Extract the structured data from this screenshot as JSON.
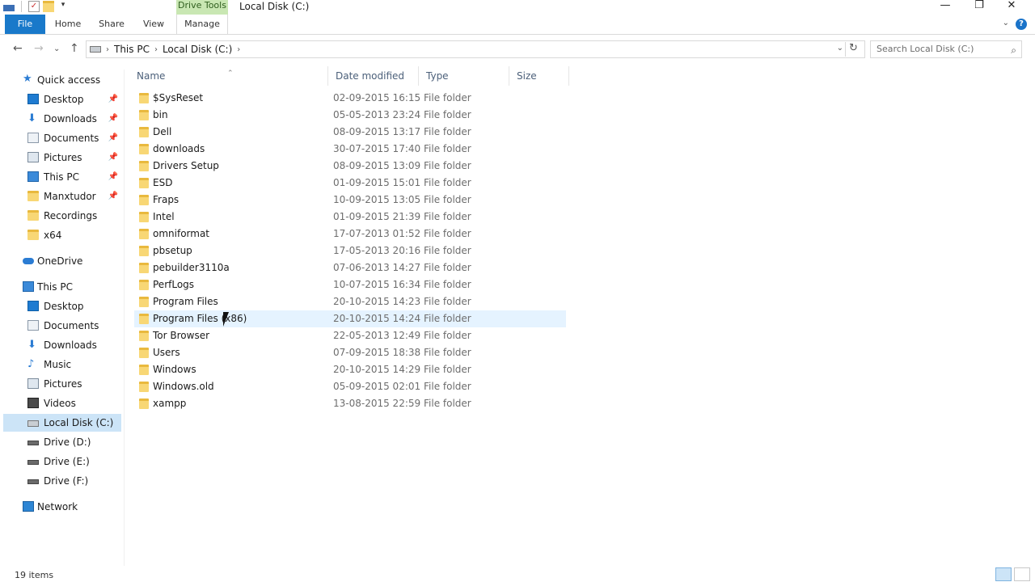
{
  "window": {
    "context_tab": "Drive Tools",
    "title": "Local Disk (C:)",
    "minimize_glyph": "—",
    "maximize_glyph": "❐",
    "close_glyph": "✕"
  },
  "ribbon": {
    "tabs": [
      {
        "label": "File"
      },
      {
        "label": "Home"
      },
      {
        "label": "Share"
      },
      {
        "label": "View"
      },
      {
        "label": "Manage"
      }
    ],
    "help_glyph": "?"
  },
  "address": {
    "crumbs": [
      "This PC",
      "Local Disk (C:)"
    ],
    "search_placeholder": "Search Local Disk (C:)"
  },
  "nav": {
    "quick_access": "Quick access",
    "quick_items": [
      {
        "label": "Desktop",
        "icon": "desktop-icon",
        "pinned": true
      },
      {
        "label": "Downloads",
        "icon": "downloads-icon",
        "pinned": true
      },
      {
        "label": "Documents",
        "icon": "documents-icon",
        "pinned": true
      },
      {
        "label": "Pictures",
        "icon": "pictures-icon",
        "pinned": true
      },
      {
        "label": "This PC",
        "icon": "this-pc-icon",
        "pinned": true
      },
      {
        "label": "Manxtudor",
        "icon": "folder-icon",
        "pinned": true
      },
      {
        "label": "Recordings",
        "icon": "folder-icon",
        "pinned": false
      },
      {
        "label": "x64",
        "icon": "folder-icon",
        "pinned": false
      }
    ],
    "onedrive": "OneDrive",
    "this_pc": "This PC",
    "pc_items": [
      {
        "label": "Desktop",
        "icon": "desktop-icon"
      },
      {
        "label": "Documents",
        "icon": "documents-icon"
      },
      {
        "label": "Downloads",
        "icon": "downloads-icon"
      },
      {
        "label": "Music",
        "icon": "music-icon"
      },
      {
        "label": "Pictures",
        "icon": "pictures-icon"
      },
      {
        "label": "Videos",
        "icon": "videos-icon"
      },
      {
        "label": "Local Disk (C:)",
        "icon": "local-disk-icon",
        "selected": true
      },
      {
        "label": "Drive (D:)",
        "icon": "drive-icon"
      },
      {
        "label": "Drive (E:)",
        "icon": "drive-icon"
      },
      {
        "label": "Drive (F:)",
        "icon": "drive-icon"
      }
    ],
    "network": "Network"
  },
  "columns": {
    "name": "Name",
    "date": "Date modified",
    "type": "Type",
    "size": "Size"
  },
  "files": [
    {
      "name": "$SysReset",
      "date": "02-09-2015 16:15",
      "type": "File folder"
    },
    {
      "name": "bin",
      "date": "05-05-2013 23:24",
      "type": "File folder"
    },
    {
      "name": "Dell",
      "date": "08-09-2015 13:17",
      "type": "File folder"
    },
    {
      "name": "downloads",
      "date": "30-07-2015 17:40",
      "type": "File folder"
    },
    {
      "name": "Drivers Setup",
      "date": "08-09-2015 13:09",
      "type": "File folder"
    },
    {
      "name": "ESD",
      "date": "01-09-2015 15:01",
      "type": "File folder"
    },
    {
      "name": "Fraps",
      "date": "10-09-2015 13:05",
      "type": "File folder"
    },
    {
      "name": "Intel",
      "date": "01-09-2015 21:39",
      "type": "File folder"
    },
    {
      "name": "omniformat",
      "date": "17-07-2013 01:52",
      "type": "File folder"
    },
    {
      "name": "pbsetup",
      "date": "17-05-2013 20:16",
      "type": "File folder"
    },
    {
      "name": "pebuilder3110a",
      "date": "07-06-2013 14:27",
      "type": "File folder"
    },
    {
      "name": "PerfLogs",
      "date": "10-07-2015 16:34",
      "type": "File folder"
    },
    {
      "name": "Program Files",
      "date": "20-10-2015 14:23",
      "type": "File folder"
    },
    {
      "name": "Program Files (x86)",
      "date": "20-10-2015 14:24",
      "type": "File folder",
      "hover": true
    },
    {
      "name": "Tor Browser",
      "date": "22-05-2013 12:49",
      "type": "File folder"
    },
    {
      "name": "Users",
      "date": "07-09-2015 18:38",
      "type": "File folder"
    },
    {
      "name": "Windows",
      "date": "20-10-2015 14:29",
      "type": "File folder"
    },
    {
      "name": "Windows.old",
      "date": "05-09-2015 02:01",
      "type": "File folder"
    },
    {
      "name": "xampp",
      "date": "13-08-2015 22:59",
      "type": "File folder"
    }
  ],
  "status": {
    "count": "19 items"
  },
  "colors": {
    "file_tab": "#1979ca",
    "drive_tools": "#c9e7b3",
    "selection": "#cce4f7",
    "hover": "#e5f3ff",
    "folder": "#f8d775"
  }
}
